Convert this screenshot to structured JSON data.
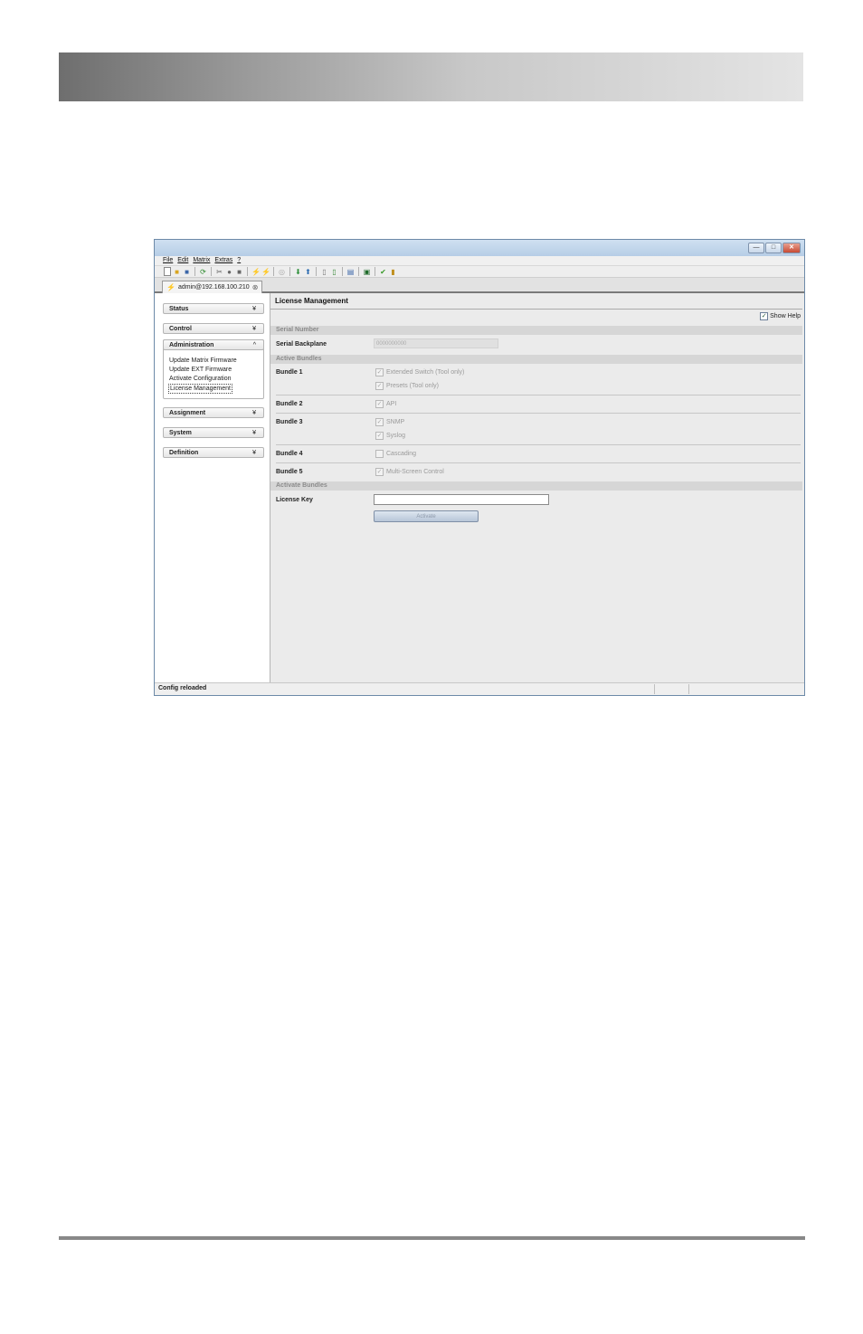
{
  "menu": {
    "file": "File",
    "edit": "Edit",
    "matrix": "Matrix",
    "extras": "Extras",
    "help": "?"
  },
  "window_controls": {
    "minimize": "—",
    "maximize": "□",
    "close": "✕"
  },
  "toolbar_icons": [
    "new-file-icon",
    "open-folder-icon",
    "save-icon",
    "refresh-icon",
    "cut-icon",
    "copy-icon",
    "paste-icon",
    "connect-icon",
    "disconnect-icon",
    "target-icon",
    "download-icon",
    "upload-icon",
    "document-icon",
    "document-export-icon",
    "report-icon",
    "monitor-icon",
    "checkmark-icon",
    "book-icon"
  ],
  "connection_tab": {
    "label": "admin@192.168.100.210"
  },
  "sidebar": {
    "status": "Status",
    "control": "Control",
    "administration": "Administration",
    "admin_items": [
      "Update Matrix Firmware",
      "Update EXT Firmware",
      "Activate Configuration",
      "License Management"
    ],
    "assignment": "Assignment",
    "system": "System",
    "definition": "Definition",
    "chev_down": "¥",
    "chev_up": "^"
  },
  "main": {
    "title": "License Management",
    "show_help": "Show Help",
    "sections": {
      "serial": "Serial Number",
      "active": "Active Bundles",
      "activate": "Activate Bundles"
    },
    "serial_label": "Serial Backplane",
    "serial_value": "0000000000",
    "bundles": [
      {
        "label": "Bundle 1",
        "options": [
          {
            "text": "Extended Switch (Tool only)",
            "checked": true
          },
          {
            "text": "Presets (Tool only)",
            "checked": true
          }
        ]
      },
      {
        "label": "Bundle 2",
        "options": [
          {
            "text": "API",
            "checked": true
          }
        ]
      },
      {
        "label": "Bundle 3",
        "options": [
          {
            "text": "SNMP",
            "checked": true
          },
          {
            "text": "Syslog",
            "checked": true
          }
        ]
      },
      {
        "label": "Bundle 4",
        "options": [
          {
            "text": "Cascading",
            "checked": false
          }
        ]
      },
      {
        "label": "Bundle 5",
        "options": [
          {
            "text": "Multi-Screen Control",
            "checked": true
          }
        ]
      }
    ],
    "license_key_label": "License Key",
    "license_key_value": "",
    "activate_button": "Activate"
  },
  "status_bar": {
    "text": "Config reloaded"
  }
}
